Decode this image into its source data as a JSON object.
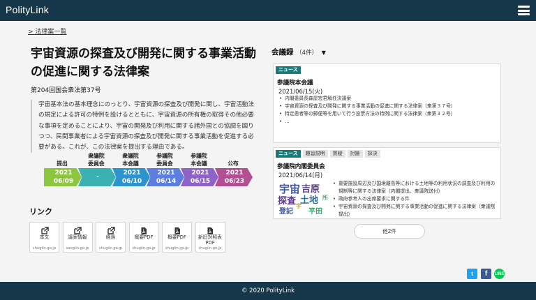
{
  "header": {
    "logo": "PolityLink",
    "menu_icon": "hamburger-icon"
  },
  "breadcrumb": "> 法律案一覧",
  "bill": {
    "title": "宇宙資源の探査及び開発に関する事業活動の促進に関する法律案",
    "number": "第204回国会衆法第37号",
    "summary": "宇宙基本法の基本理念にのっとり、宇宙資源の探査及び開発に関し、宇宙活動法の規定による許可の特例を設けるとともに、宇宙資源の所有権の取得その他必要な事項を定めることにより、宇宙の開発及び利用に関する諸外国との協調を図りつつ、民間事業者による宇宙資源の探査及び開発に関する事業活動を促進する必要がある。これが、この法律案を提出する理由である。"
  },
  "progress": [
    {
      "label_line1": "提出",
      "label_line2": "",
      "value_line1": "2021",
      "value_line2": "06/09",
      "color": "#8cc63e"
    },
    {
      "label_line1": "衆議院",
      "label_line2": "委員会",
      "value_line1": "-",
      "value_line2": "",
      "color": "#3ab1b0"
    },
    {
      "label_line1": "衆議院",
      "label_line2": "本会議",
      "value_line1": "2021",
      "value_line2": "06/10",
      "color": "#2d93cf"
    },
    {
      "label_line1": "参議院",
      "label_line2": "委員会",
      "value_line1": "2021",
      "value_line2": "06/14",
      "color": "#5b7ee0"
    },
    {
      "label_line1": "参議院",
      "label_line2": "本会議",
      "value_line1": "2021",
      "value_line2": "06/15",
      "color": "#8e63c8"
    },
    {
      "label_line1": "公布",
      "label_line2": "",
      "value_line1": "2021",
      "value_line2": "06/23",
      "color": "#b24f92"
    }
  ],
  "links": {
    "heading": "リンク",
    "items": [
      {
        "icon": "external-link-icon",
        "label": "本文",
        "domain": "shugiin.go.jp"
      },
      {
        "icon": "external-link-icon",
        "label": "議案情報",
        "domain": "sangiin.go.jp"
      },
      {
        "icon": "external-link-icon",
        "label": "経過",
        "domain": "shugiin.go.jp"
      },
      {
        "icon": "pdf-icon",
        "label": "概要PDF",
        "domain": "shugiin.go.jp"
      },
      {
        "icon": "pdf-icon",
        "label": "概要PDF",
        "domain": "shugiin.go.jp"
      },
      {
        "icon": "pdf-icon",
        "label": "新旧対照表PDF",
        "domain": "shugiin.go.jp"
      }
    ]
  },
  "records": {
    "heading": "会議録",
    "count": "（4件）",
    "cards": [
      {
        "tags": [
          "ニュース"
        ],
        "title": "参議院本会議",
        "date": "2021/06/15(火)",
        "items": [
          "内閣委員長森屋宏君解任決議案",
          "宇宙資源の探査及び開発に関する事業活動の促進に関する法律案（衆第３７号）",
          "特定患者等の郵便等を用いて行う投票方法の特例に関する法律案（衆第３２号）",
          "…"
        ]
      },
      {
        "tags": [
          "ニュース",
          "趣旨説明",
          "質疑",
          "討論",
          "採決"
        ],
        "title": "参議院内閣委員会",
        "date": "2021/06/14(月)",
        "cloud": [
          "宇宙",
          "吉原",
          "探査",
          "土地",
          "登記",
          "平田",
          "宇",
          "所"
        ],
        "items": [
          "重要施設周辺及び国境離島等における土地等の利用状況の調査及び利用の規制等に関する法律案（内閣提出、衆議院送付）",
          "政府参考人の出席要求に関する件",
          "宇宙資源の探査及び開発に関する事業活動の促進に関する法律案（衆議院提出）"
        ]
      }
    ],
    "more_button": "他2件"
  },
  "share": {
    "twitter": "t",
    "facebook": "f",
    "line": "LINE"
  },
  "footer": "© 2020 PolityLink"
}
